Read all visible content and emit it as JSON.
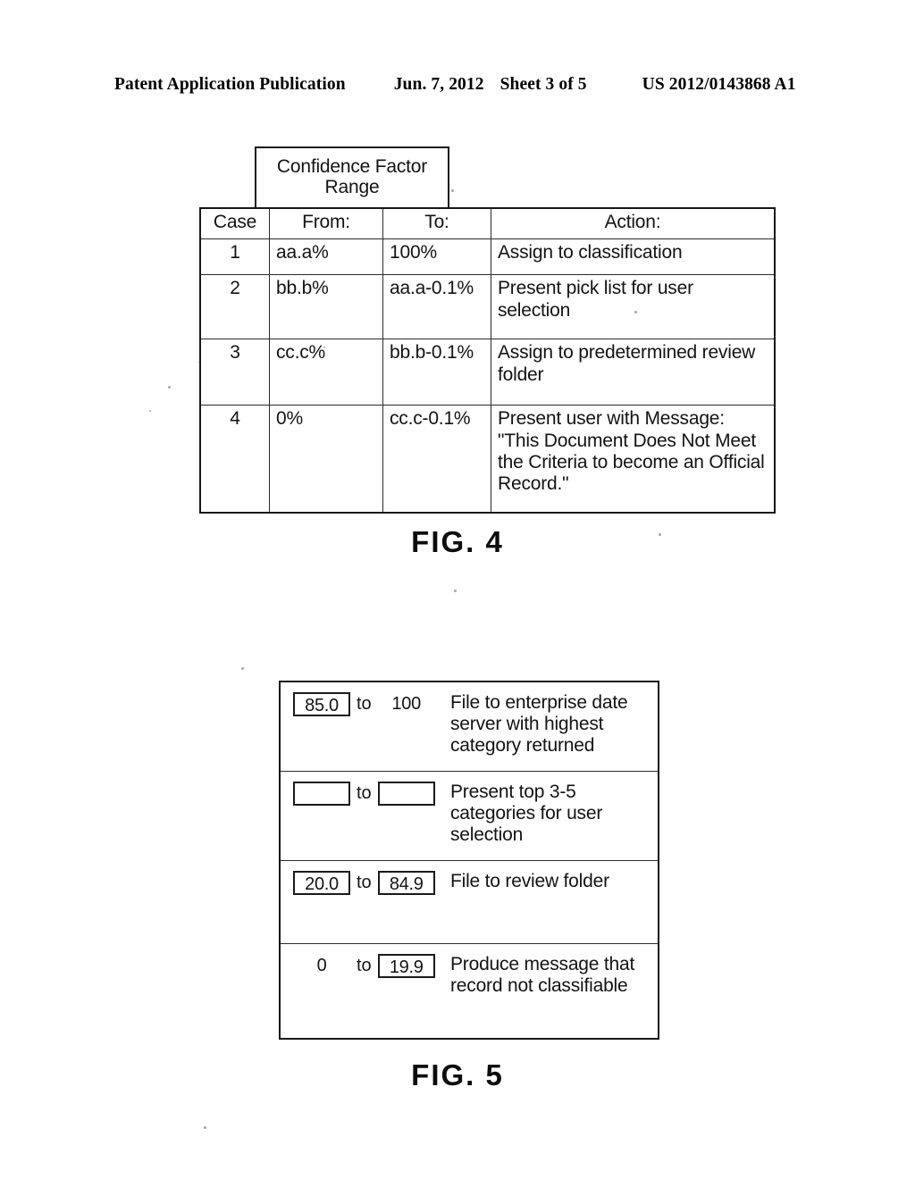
{
  "header": {
    "publication": "Patent Application Publication",
    "date": "Jun. 7, 2012",
    "sheet": "Sheet 3 of 5",
    "patent_number": "US 2012/0143868 A1"
  },
  "figure4": {
    "caption": "FIG. 4",
    "group_header": "Confidence Factor Range",
    "columns": {
      "case": "Case",
      "from": "From:",
      "to": "To:",
      "action": "Action:"
    },
    "rows": [
      {
        "case": "1",
        "from": "aa.a%",
        "to": "100%",
        "action": "Assign to classification"
      },
      {
        "case": "2",
        "from": "bb.b%",
        "to": "aa.a-0.1%",
        "action": "Present pick list for user selection"
      },
      {
        "case": "3",
        "from": "cc.c%",
        "to": "bb.b-0.1%",
        "action": "Assign to predetermined review folder"
      },
      {
        "case": "4",
        "from": "0%",
        "to": "cc.c-0.1%",
        "action": "Present user with Message: \"This Document Does Not Meet the Criteria to become an Official Record.\""
      }
    ]
  },
  "figure5": {
    "caption": "FIG. 5",
    "to_label": "to",
    "rows": [
      {
        "from_value": "85.0",
        "from_boxed": true,
        "to_value": "100",
        "to_boxed": false,
        "action": "File to enterprise date server with highest category returned"
      },
      {
        "from_value": "",
        "from_boxed": true,
        "to_value": "",
        "to_boxed": true,
        "action": "Present top 3-5 categories for user selection"
      },
      {
        "from_value": "20.0",
        "from_boxed": true,
        "to_value": "84.9",
        "to_boxed": true,
        "action": "File to review folder"
      },
      {
        "from_value": "0",
        "from_boxed": false,
        "to_value": "19.9",
        "to_boxed": true,
        "action": "Produce message that record not classifiable"
      }
    ]
  }
}
